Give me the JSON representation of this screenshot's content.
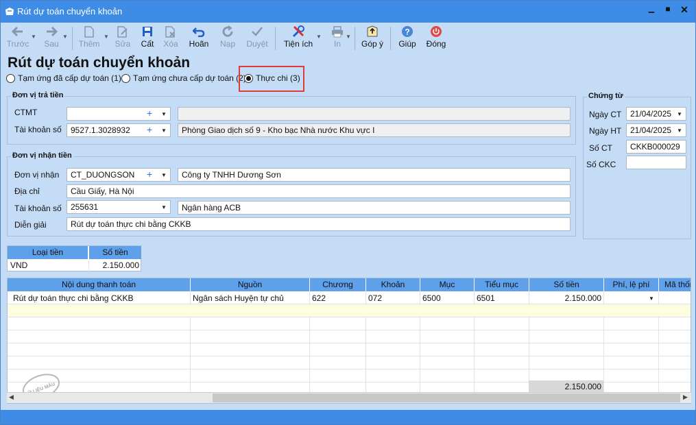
{
  "window": {
    "title": "Rút dự toán chuyển khoản",
    "minimize": "▁",
    "maximize": "■",
    "close": "✕"
  },
  "toolbar": {
    "back": "Trước",
    "next": "Sau",
    "add": "Thêm",
    "edit": "Sửa",
    "save": "Cất",
    "delete": "Xóa",
    "undo": "Hoãn",
    "load": "Nạp",
    "approve": "Duyệt",
    "utilities": "Tiện ích",
    "print": "In",
    "feedback": "Góp ý",
    "help": "Giúp",
    "close": "Đóng"
  },
  "form": {
    "heading": "Rút dự toán chuyển khoản",
    "options": [
      {
        "label": "Tạm ứng đã cấp dự toán (1)",
        "selected": false
      },
      {
        "label": "Tạm ứng chưa cấp dự toán (2)",
        "selected": false
      },
      {
        "label": "Thực chi (3)",
        "selected": true
      }
    ],
    "payer": {
      "legend": "Đơn vị trả tiền",
      "ctmt_label": "CTMT",
      "ctmt_value": "",
      "ctmt_desc": "",
      "account_label": "Tài khoản số",
      "account_value": "9527.1.3028932",
      "account_desc": "Phòng Giao dịch số 9 - Kho bạc Nhà nước Khu vực I"
    },
    "payee": {
      "legend": "Đơn vị nhận tiền",
      "unit_label": "Đơn vị nhận",
      "unit_value": "CT_DUONGSON",
      "unit_name": "Công ty TNHH Dương Sơn",
      "address_label": "Địa chỉ",
      "address_value": "Cầu Giấy, Hà Nội",
      "account_label": "Tài khoản số",
      "account_value": "255631",
      "bank_value": "Ngân hàng ACB",
      "desc_label": "Diễn giải",
      "desc_value": "Rút dự toán thực chi bằng CKKB"
    },
    "voucher": {
      "legend": "Chứng từ",
      "date_ct_label": "Ngày CT",
      "date_ct": "21/04/2025",
      "date_ht_label": "Ngày HT",
      "date_ht": "21/04/2025",
      "no_ct_label": "Số CT",
      "no_ct": "CKKB000029",
      "no_ckc_label": "Số CKC",
      "no_ckc": ""
    }
  },
  "currency_grid": {
    "headers": [
      "Loại tiền",
      "Số tiền"
    ],
    "row": [
      "VND",
      "2.150.000"
    ]
  },
  "detail_grid": {
    "headers": [
      "Nội dung thanh toán",
      "Nguồn",
      "Chương",
      "Khoản",
      "Mục",
      "Tiểu mục",
      "Số tiền",
      "Phí, lệ phí",
      "Mã thốn"
    ],
    "row": [
      "Rút dự toán thực chi bằng CKKB",
      "Ngân sách Huyện tự chủ",
      "622",
      "072",
      "6500",
      "6501",
      "2.150.000",
      ""
    ],
    "total": "2.150.000",
    "stamp": "DỮ LIỆU MẪU"
  },
  "colors": {
    "titlebar": "#3e8ce6",
    "background": "#c5dcf6",
    "header": "#5fa0eb",
    "highlight": "#e03a3a"
  }
}
